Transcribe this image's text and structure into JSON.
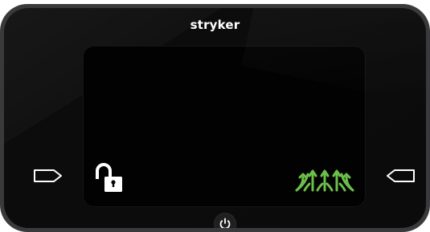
{
  "device": {
    "brand": "stryker",
    "colors": {
      "bezel": "#0b0b0b",
      "bezel_rim": "#3a3a3c",
      "screen": "#020202",
      "icon_white": "#ffffff",
      "active_green": "#6cc04a"
    }
  },
  "controls": {
    "left_button_icon": "arrow-right-outline-icon",
    "right_button_icon": "arrow-left-outline-icon",
    "power_button_icon": "power-icon"
  },
  "screen": {
    "lock_status_icon": "unlocked-padlock-icon",
    "mode_icon": "green-arrows-mode-icon"
  }
}
